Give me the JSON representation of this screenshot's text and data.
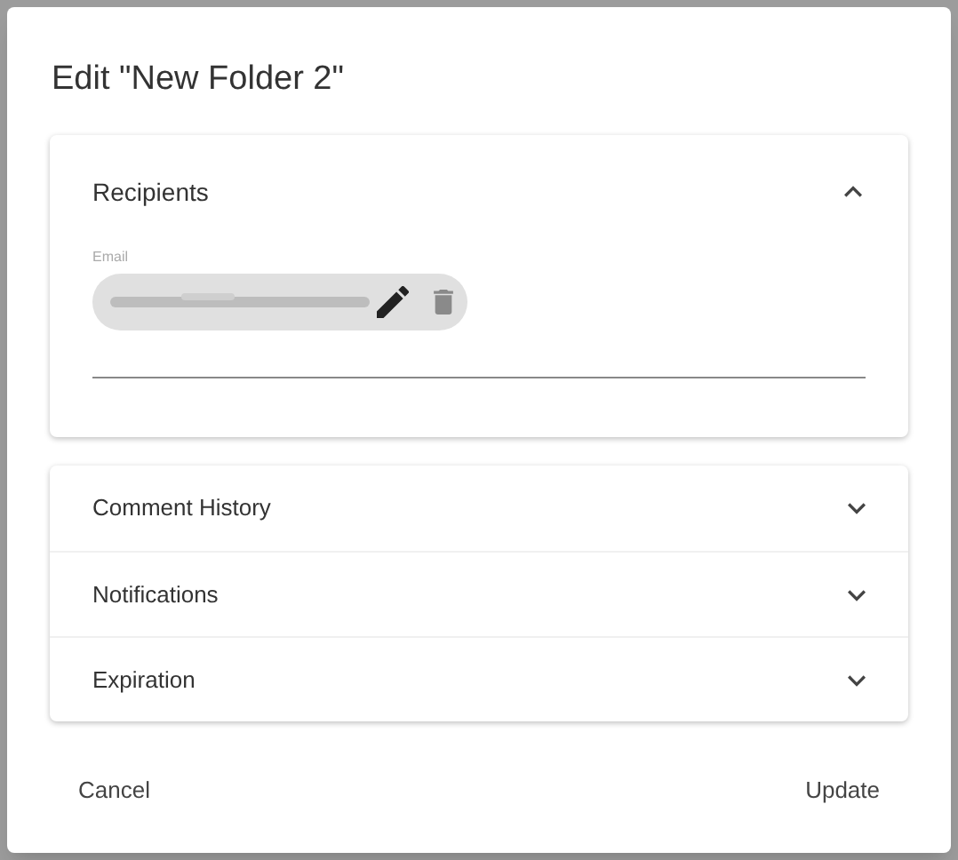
{
  "dialog": {
    "title": "Edit \"New Folder 2\""
  },
  "recipients": {
    "title": "Recipients",
    "expanded": true,
    "field_label": "Email",
    "chips": [
      {
        "kind": "redacted"
      }
    ]
  },
  "sections": [
    {
      "title": "Comment History",
      "expanded": false
    },
    {
      "title": "Notifications",
      "expanded": false
    },
    {
      "title": "Expiration",
      "expanded": false
    }
  ],
  "buttons": [
    {
      "label": "Cancel"
    },
    {
      "label": "Update"
    }
  ]
}
